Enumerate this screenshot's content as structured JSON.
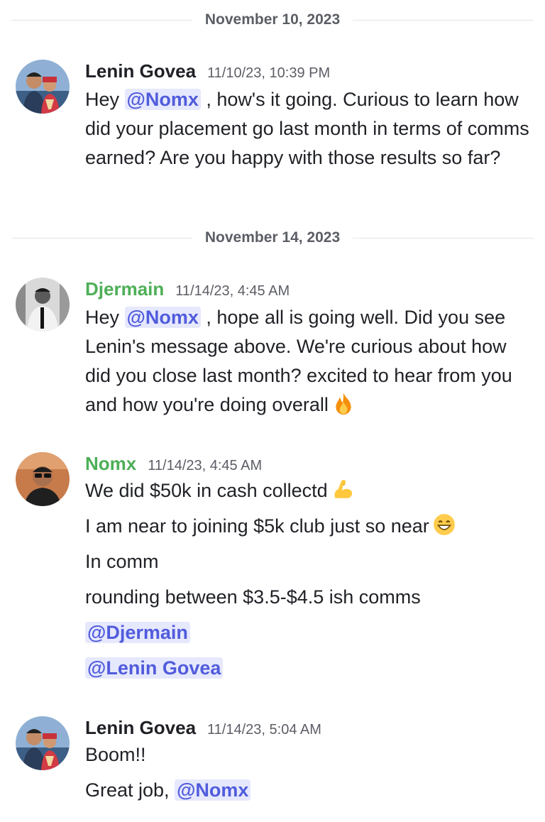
{
  "dividers": [
    {
      "label": "November 10, 2023"
    },
    {
      "label": "November 14, 2023"
    }
  ],
  "messages": [
    {
      "author": "Lenin Govea",
      "timestamp": "11/10/23, 10:39 PM",
      "text_pre": "Hey ",
      "mention": "@Nomx",
      "text_post": " , how's it going. Curious to learn how did your placement go last month in terms of comms earned? Are you happy with those results so far?"
    },
    {
      "author": "Djermain",
      "timestamp": "11/14/23, 4:45 AM",
      "text_pre": "Hey ",
      "mention": "@Nomx",
      "text_post": " , hope all is going well. Did you see Lenin's message above. We're curious about how did you close last month? excited to hear from you and how you're doing overall",
      "emoji": "fire-emoji"
    },
    {
      "author": "Nomx",
      "timestamp": "11/14/23, 4:45 AM",
      "lines": [
        {
          "text": "We did $50k in cash collectd",
          "emoji": "flexed-biceps-emoji"
        },
        {
          "text": "I am near to joining $5k club just so near",
          "emoji": "grinning-face-emoji"
        },
        {
          "text": "In comm"
        },
        {
          "text": "rounding between $3.5-$4.5 ish comms"
        }
      ],
      "mentions": [
        "@Djermain",
        "@Lenin Govea"
      ]
    },
    {
      "author": "Lenin Govea",
      "timestamp": "11/14/23, 5:04 AM",
      "line1": "Boom!!",
      "line2_pre": "Great job, ",
      "line2_mention": "@Nomx"
    }
  ],
  "colors": {
    "mention_bg": "#e6e8fd",
    "mention_text": "#505cdc",
    "role_green": "#4daf57",
    "divider": "#e3e5e8"
  }
}
